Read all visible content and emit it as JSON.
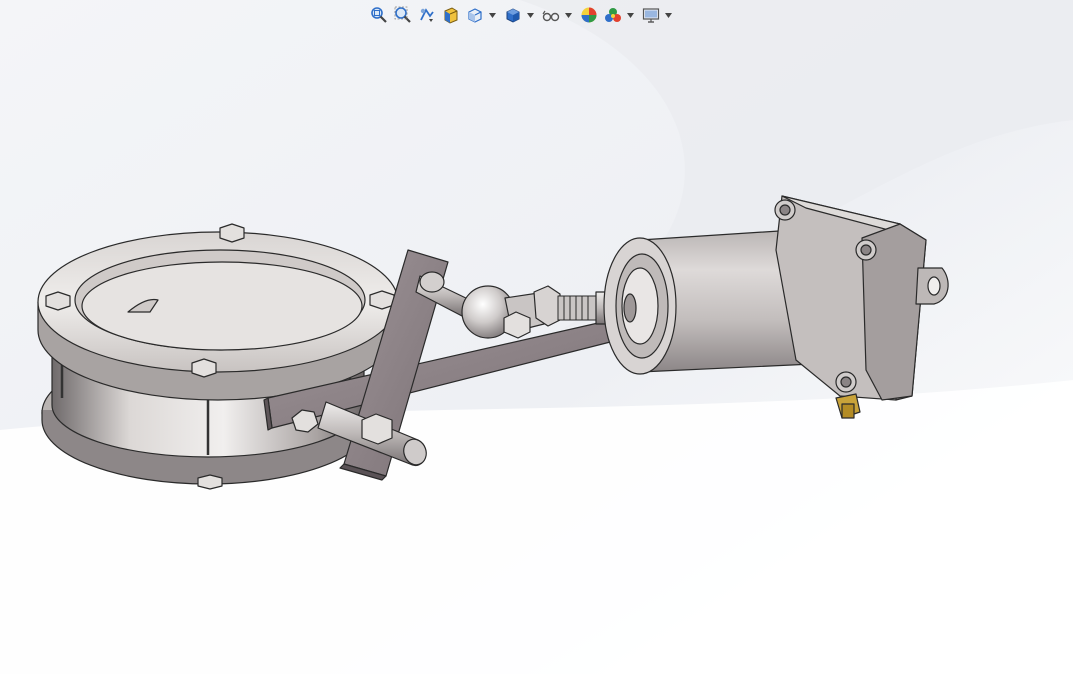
{
  "app": {
    "domain_view": "cad-3d-viewport"
  },
  "toolbar": {
    "items": [
      {
        "id": "zoom-to-fit",
        "icon": "zoom-to-fit-icon",
        "dropdown": false
      },
      {
        "id": "zoom-to-area",
        "icon": "zoom-to-area-icon",
        "dropdown": false
      },
      {
        "id": "previous-view",
        "icon": "previous-view-icon",
        "dropdown": false
      },
      {
        "id": "section-view",
        "icon": "section-view-icon",
        "dropdown": false
      },
      {
        "id": "view-orientation",
        "icon": "view-orientation-icon",
        "dropdown": true
      },
      {
        "id": "display-style",
        "icon": "display-style-icon",
        "dropdown": true
      },
      {
        "id": "hide-show-items",
        "icon": "hide-show-items-icon",
        "dropdown": true
      },
      {
        "id": "edit-appearance",
        "icon": "edit-appearance-icon",
        "dropdown": false
      },
      {
        "id": "apply-scene",
        "icon": "apply-scene-icon",
        "dropdown": true
      },
      {
        "id": "view-settings",
        "icon": "view-settings-icon",
        "dropdown": true
      }
    ]
  },
  "colors": {
    "background_top": "#f3f4f7",
    "background_bottom": "#ffffff",
    "metal_light": "#eceae8",
    "metal_mid": "#bdb8b6",
    "metal_dark": "#7c7677",
    "plate": "#8f8589",
    "brass": "#c9a33a",
    "edge": "#2a2a2a",
    "icon_blue": "#2f6fc9"
  }
}
